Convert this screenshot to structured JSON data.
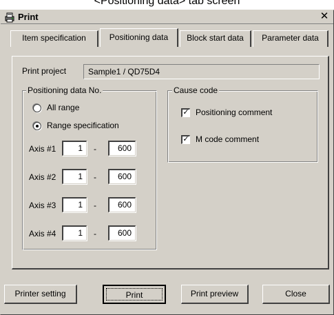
{
  "caption": "<Positioning data> tab screen",
  "window": {
    "title": "Print",
    "close_glyph": "✕",
    "icon": "print-app-icon"
  },
  "tabs": [
    {
      "label": "Item specification",
      "active": false
    },
    {
      "label": "Positioning data",
      "active": true
    },
    {
      "label": "Block start data",
      "active": false
    },
    {
      "label": "Parameter data",
      "active": false
    }
  ],
  "print_project": {
    "label": "Print project",
    "value": "Sample1 / QD75D4"
  },
  "positioning_group": {
    "title": "Positioning data No.",
    "all_range_label": "All range",
    "all_range_selected": false,
    "range_spec_label": "Range specification",
    "range_spec_selected": true,
    "separator": "-",
    "axes": [
      {
        "label": "Axis #1",
        "from": "1",
        "to": "600"
      },
      {
        "label": "Axis #2",
        "from": "1",
        "to": "600"
      },
      {
        "label": "Axis #3",
        "from": "1",
        "to": "600"
      },
      {
        "label": "Axis #4",
        "from": "1",
        "to": "600"
      }
    ]
  },
  "cause_group": {
    "title": "Cause code",
    "positioning_comment_label": "Positioning comment",
    "positioning_comment_checked": true,
    "m_code_comment_label": "M code comment",
    "m_code_comment_checked": true,
    "check_glyph": "✓"
  },
  "buttons": {
    "printer_setting": "Printer setting",
    "print": "Print",
    "print_preview": "Print preview",
    "close": "Close"
  }
}
